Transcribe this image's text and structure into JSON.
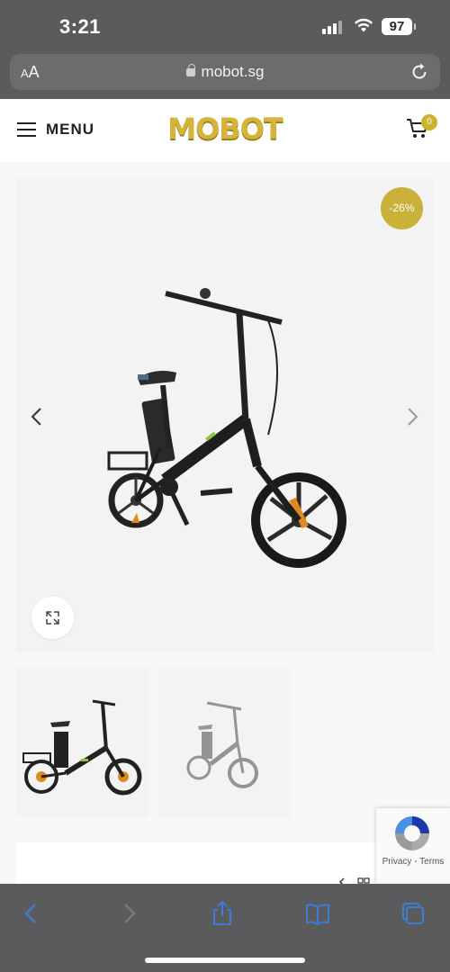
{
  "status_bar": {
    "time": "3:21",
    "battery": "97"
  },
  "browser": {
    "text_size_label": "AA",
    "url": "mobot.sg"
  },
  "header": {
    "menu_label": "MENU",
    "logo_text": "MOBOT",
    "cart_count": "0"
  },
  "product": {
    "discount_badge": "-26%",
    "images": [
      "main-bike-image",
      "thumbnail-1",
      "thumbnail-2"
    ]
  },
  "recaptcha": {
    "privacy": "Privacy",
    "separator": " - ",
    "terms": "Terms"
  },
  "colors": {
    "accent": "#c9b13a",
    "chrome": "#5b5b5d",
    "ios_blue": "#3d7bd8"
  },
  "icons": [
    "search-icon",
    "chevron-left-icon",
    "chevron-right-icon",
    "expand-icon",
    "cart-icon",
    "share-icon",
    "bookmarks-icon",
    "tabs-icon"
  ]
}
